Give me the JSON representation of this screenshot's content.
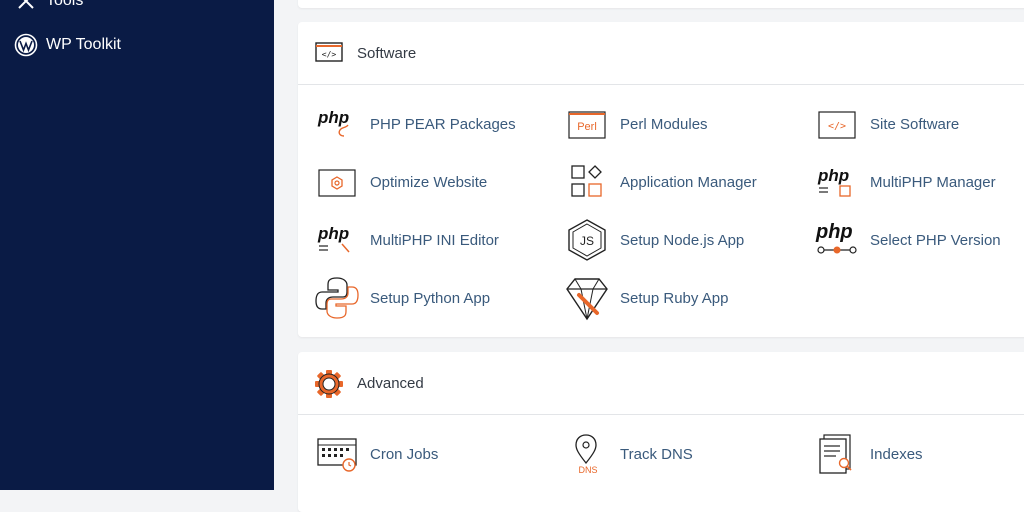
{
  "sidebar": {
    "items": [
      {
        "label": "Tools",
        "icon": "tools-icon"
      },
      {
        "label": "WP Toolkit",
        "icon": "wordpress-icon"
      }
    ]
  },
  "software": {
    "title": "Software",
    "items": [
      {
        "label": "PHP PEAR Packages",
        "icon": "php-pear-icon"
      },
      {
        "label": "Perl Modules",
        "icon": "perl-icon"
      },
      {
        "label": "Site Software",
        "icon": "code-window-icon"
      },
      {
        "label": "Optimize Website",
        "icon": "optimize-icon"
      },
      {
        "label": "Application Manager",
        "icon": "app-manager-icon"
      },
      {
        "label": "MultiPHP Manager",
        "icon": "multiphp-manager-icon"
      },
      {
        "label": "MultiPHP INI Editor",
        "icon": "multiphp-ini-icon"
      },
      {
        "label": "Setup Node.js App",
        "icon": "nodejs-icon"
      },
      {
        "label": "Select PHP Version",
        "icon": "php-version-icon"
      },
      {
        "label": "Setup Python App",
        "icon": "python-icon"
      },
      {
        "label": "Setup Ruby App",
        "icon": "ruby-icon"
      }
    ]
  },
  "advanced": {
    "title": "Advanced",
    "items": [
      {
        "label": "Cron Jobs",
        "icon": "cron-icon"
      },
      {
        "label": "Track DNS",
        "icon": "track-dns-icon",
        "icon_text": "DNS"
      },
      {
        "label": "Indexes",
        "icon": "indexes-icon"
      }
    ]
  },
  "icon_text": {
    "php": "php",
    "perl": "Perl",
    "js": "JS"
  },
  "colors": {
    "sidebar_bg": "#0a1b45",
    "accent": "#e8672a",
    "link": "#3a5a7c"
  }
}
